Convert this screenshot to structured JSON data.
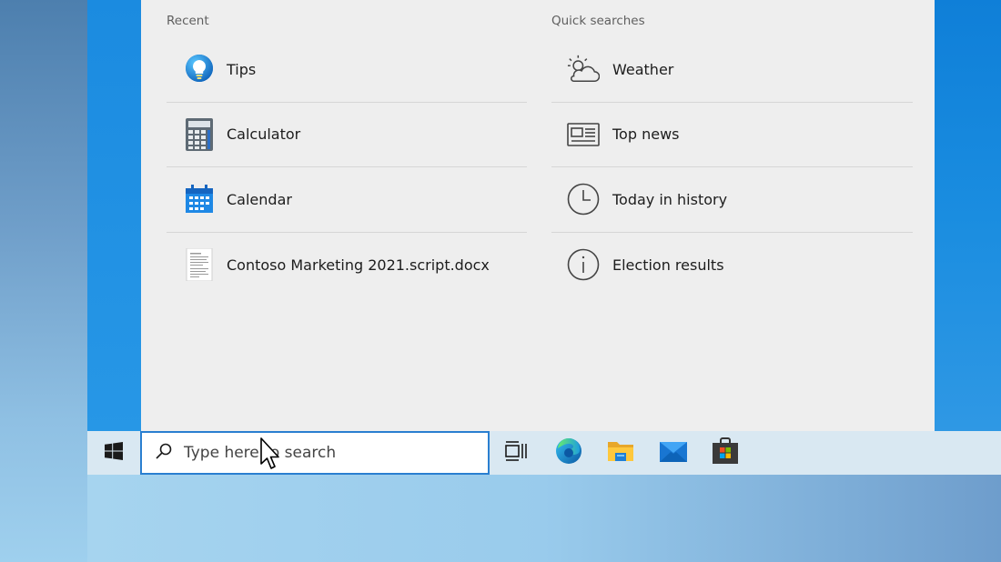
{
  "search_panel": {
    "recent": {
      "title": "Recent",
      "items": [
        {
          "label": "Tips",
          "icon": "tips-icon"
        },
        {
          "label": "Calculator",
          "icon": "calculator-icon"
        },
        {
          "label": "Calendar",
          "icon": "calendar-icon"
        },
        {
          "label": "Contoso Marketing 2021.script.docx",
          "icon": "document-icon"
        }
      ]
    },
    "quick_searches": {
      "title": "Quick searches",
      "items": [
        {
          "label": "Weather",
          "icon": "weather-icon"
        },
        {
          "label": "Top news",
          "icon": "news-icon"
        },
        {
          "label": "Today in history",
          "icon": "clock-icon"
        },
        {
          "label": "Election results",
          "icon": "info-icon"
        }
      ]
    }
  },
  "taskbar": {
    "search_placeholder": "Type here to search",
    "icons": [
      "windows-start-icon",
      "task-view-icon",
      "edge-icon",
      "file-explorer-icon",
      "mail-icon",
      "store-icon"
    ]
  },
  "colors": {
    "accent": "#2a7fd0",
    "panel_bg": "#eeeeee",
    "taskbar_bg": "#d9e8f2"
  }
}
